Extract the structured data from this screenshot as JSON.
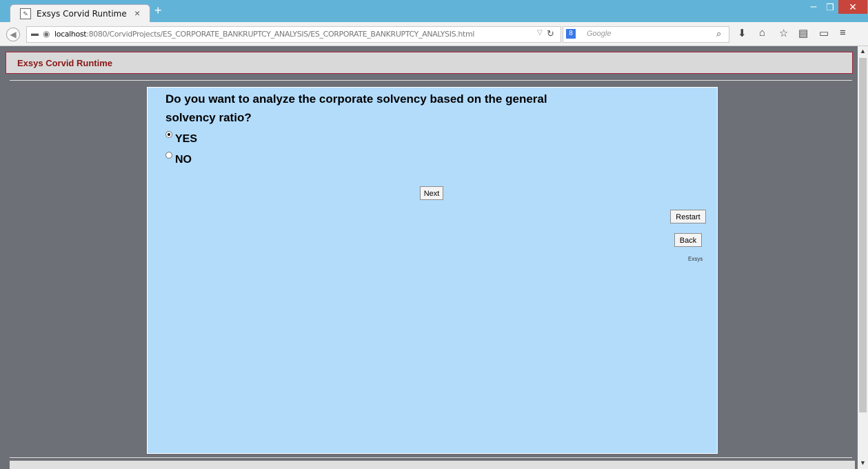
{
  "browser": {
    "tab_title": "Exsys Corvid Runtime",
    "tab_close": "×",
    "new_tab": "+",
    "window_min": "–",
    "window_max": "❐",
    "window_close": "✕",
    "url_host": "localhost",
    "url_rest": ":8080/CorvidProjects/ES_CORPORATE_BANKRUPTCY_ANALYSIS/ES_CORPORATE_BANKRUPTCY_ANALYSIS.html",
    "search_placeholder": "Google",
    "search_engine_letter": "8"
  },
  "icons": {
    "back": "arrow-left-icon",
    "identity": "identity-icon",
    "globe": "globe-icon",
    "reload": "reload-icon",
    "search": "search-icon",
    "downloads": "download-icon",
    "home": "home-icon",
    "bookmark": "star-icon",
    "reading": "reading-list-icon",
    "extension": "extension-icon",
    "menu": "hamburger-menu-icon"
  },
  "app": {
    "title": "Exsys Corvid Runtime"
  },
  "question": {
    "text": "Do you want to analyze the corporate solvency based on the general solvency ratio?",
    "options": [
      {
        "label": "YES",
        "selected": true
      },
      {
        "label": "NO",
        "selected": false
      }
    ]
  },
  "buttons": {
    "next": "Next",
    "restart": "Restart",
    "back": "Back"
  },
  "footer_label": "Exsys",
  "colors": {
    "panel_bg": "#b3dcfb",
    "page_bg": "#6e7077",
    "title_color": "#8a1616",
    "titlebar": "#62b3d8"
  }
}
